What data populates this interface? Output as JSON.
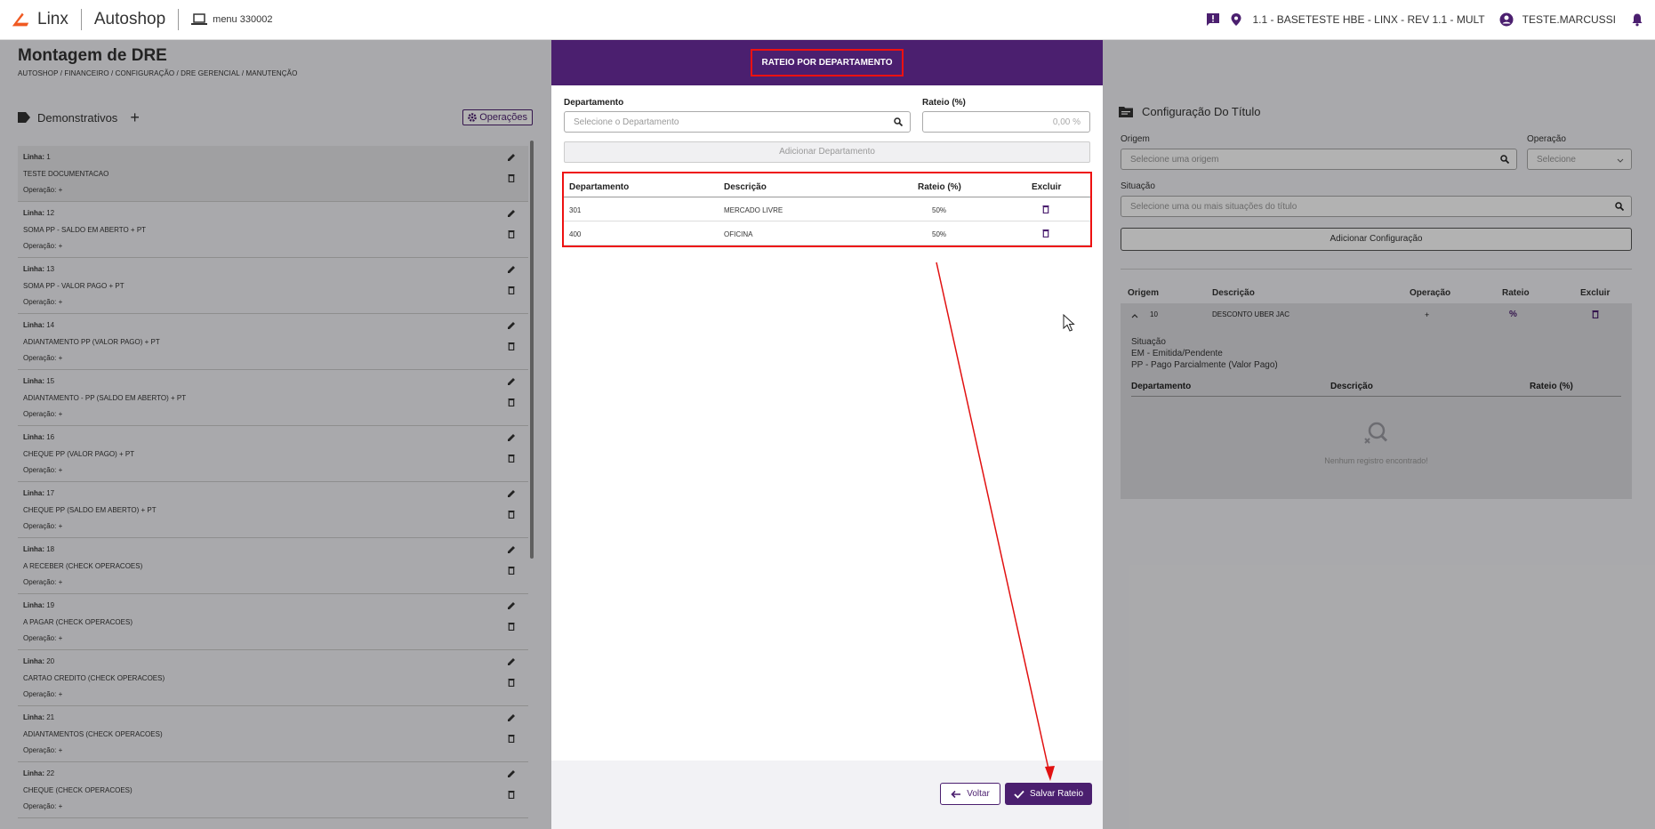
{
  "header": {
    "brand": "Linx",
    "app": "Autoshop",
    "menu_ref": "menu 330002",
    "location": "1.1 - BASETESTE HBE - LINX - REV 1.1 - MULT",
    "user": "TESTE.MARCUSSI"
  },
  "page": {
    "title": "Montagem de DRE",
    "breadcrumb": "AUTOSHOP / FINANCEIRO / CONFIGURAÇÃO / DRE GERENCIAL / MANUTENÇÃO"
  },
  "left_panel": {
    "title": "Demonstrativos",
    "add_symbol": "+",
    "ops_label": "Operações",
    "line_label": "Linha:",
    "op_label": "Operação:",
    "items": [
      {
        "line": "1",
        "desc": "TESTE DOCUMENTACAO",
        "op": "+"
      },
      {
        "line": "12",
        "desc": "SOMA PP - SALDO EM ABERTO + PT",
        "op": "+"
      },
      {
        "line": "13",
        "desc": "SOMA PP - VALOR PAGO + PT",
        "op": "+"
      },
      {
        "line": "14",
        "desc": "ADIANTAMENTO PP (VALOR PAGO) + PT",
        "op": "+"
      },
      {
        "line": "15",
        "desc": "ADIANTAMENTO - PP (SALDO EM ABERTO) + PT",
        "op": "+"
      },
      {
        "line": "16",
        "desc": "CHEQUE PP (VALOR PAGO) + PT",
        "op": "+"
      },
      {
        "line": "17",
        "desc": "CHEQUE PP (SALDO EM ABERTO) + PT",
        "op": "+"
      },
      {
        "line": "18",
        "desc": "A RECEBER (CHECK OPERACOES)",
        "op": "+"
      },
      {
        "line": "19",
        "desc": "A PAGAR (CHECK OPERACOES)",
        "op": "+"
      },
      {
        "line": "20",
        "desc": "CARTAO CREDITO (CHECK OPERACOES)",
        "op": "+"
      },
      {
        "line": "21",
        "desc": "ADIANTAMENTOS (CHECK OPERACOES)",
        "op": "+"
      },
      {
        "line": "22",
        "desc": "CHEQUE (CHECK OPERACOES)",
        "op": "+"
      }
    ]
  },
  "right_panel": {
    "title": "Configuração Do Título",
    "origem_label": "Origem",
    "origem_placeholder": "Selecione uma origem",
    "operacao_label": "Operação",
    "operacao_placeholder": "Selecione",
    "situacao_label": "Situação",
    "situacao_placeholder": "Selecione uma ou mais situações do título",
    "add_config": "Adicionar Configuração",
    "table_headers": {
      "origem": "Origem",
      "descricao": "Descrição",
      "operacao": "Operação",
      "rateio": "Rateio",
      "excluir": "Excluir"
    },
    "row": {
      "origem": "10",
      "descricao": "DESCONTO UBER JAC",
      "operacao": "+",
      "rateio_icon": "%"
    },
    "detail": {
      "situacao_title": "Situação",
      "situacao_1": "EM - Emitida/Pendente",
      "situacao_2": "PP - Pago Parcialmente (Valor Pago)",
      "dep_headers": {
        "departamento": "Departamento",
        "descricao": "Descrição",
        "rateio": "Rateio (%)"
      },
      "empty": "Nenhum registro encontrado!"
    }
  },
  "modal": {
    "title": "RATEIO POR DEPARTAMENTO",
    "dep_label": "Departamento",
    "dep_placeholder": "Selecione o Departamento",
    "rateio_label": "Rateio (%)",
    "rateio_placeholder": "0,00 %",
    "add_button": "Adicionar Departamento",
    "table_headers": {
      "departamento": "Departamento",
      "descricao": "Descrição",
      "rateio": "Rateio (%)",
      "excluir": "Excluir"
    },
    "rows": [
      {
        "departamento": "301",
        "descricao": "MERCADO LIVRE",
        "rateio": "50%"
      },
      {
        "departamento": "400",
        "descricao": "OFICINA",
        "rateio": "50%"
      }
    ],
    "back_button": "Voltar",
    "save_button": "Salvar Rateio"
  },
  "colors": {
    "brand_purple": "#4b1f6f",
    "annotation_red": "#e11111",
    "logo_orange": "#f05a22"
  }
}
